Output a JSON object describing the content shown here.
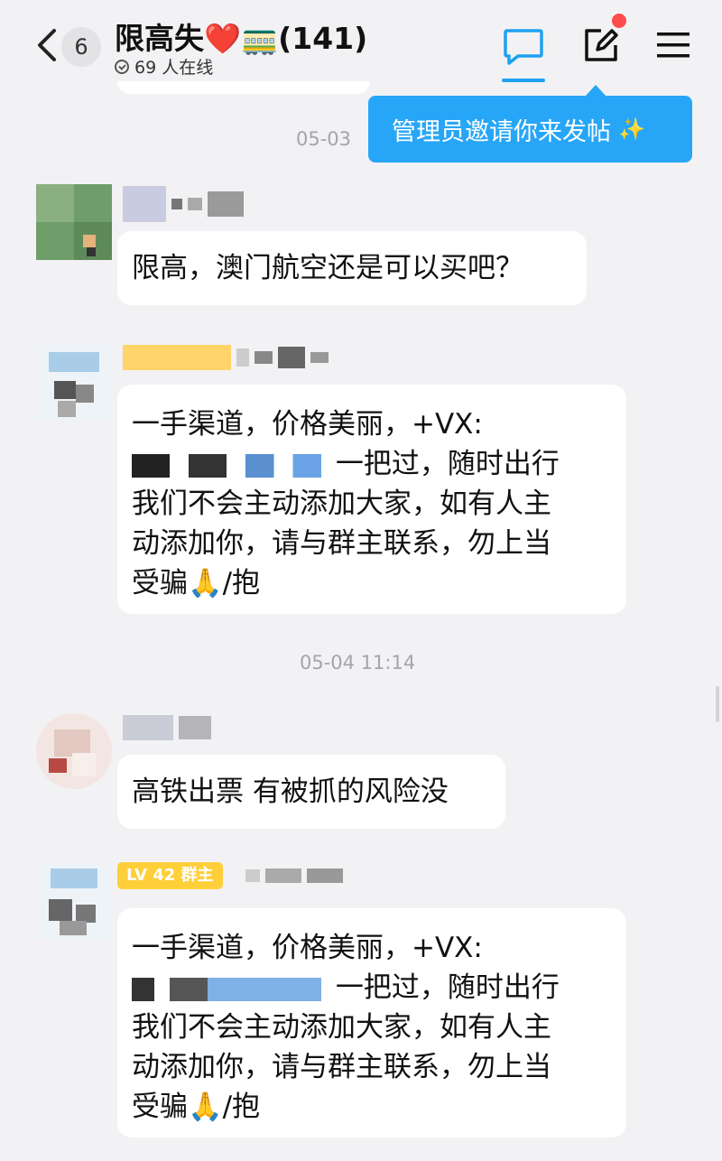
{
  "header": {
    "back_count": "6",
    "title": "限高失❤️🚃(141)",
    "online_text": "69 人在线"
  },
  "tooltip": {
    "text": "管理员邀请你来发帖",
    "sparkle": "✨"
  },
  "messages": [
    {
      "type": "time",
      "text": "05-03"
    },
    {
      "type": "msg",
      "text_lines": [
        "限高，澳门航空还是可以买吧？"
      ]
    },
    {
      "type": "msg",
      "text_lines": [
        "一手渠道，价格美丽，+VX:",
        "一把过，随时出行",
        "我们不会主动添加大家，如有人主",
        "动添加你，请与群主联系，勿上当",
        "受骗🙏/抱"
      ]
    },
    {
      "type": "time",
      "text": "05-04 11:14"
    },
    {
      "type": "msg",
      "text_lines": [
        "高铁出票 有被抓的风险没"
      ]
    },
    {
      "type": "msg",
      "badge": "LV 42 群主",
      "text_lines": [
        "一手渠道，价格美丽，+VX:",
        "一把过，随时出行",
        "我们不会主动添加大家，如有人主",
        "动添加你，请与群主联系，勿上当",
        "受骗🙏/抱"
      ]
    }
  ],
  "colors": {
    "accent": "#1da1f2",
    "tooltip_bg": "#27a6f7",
    "badge_bg": "#ffcf3a",
    "background": "#f2f2f4"
  }
}
